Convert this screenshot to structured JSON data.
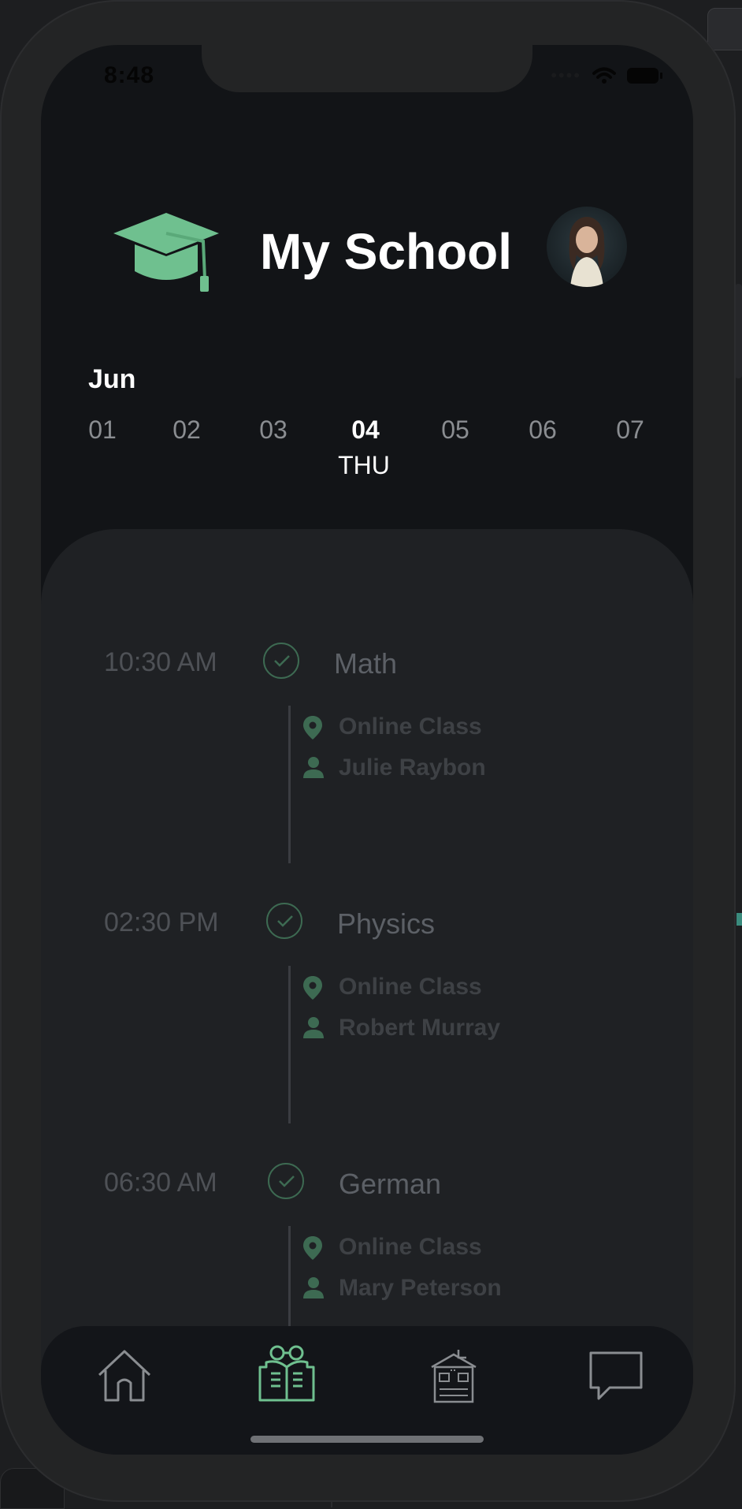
{
  "status": {
    "time": "8:48"
  },
  "header": {
    "title": "My School"
  },
  "calendar": {
    "month": "Jun",
    "days": [
      "01",
      "02",
      "03",
      "04",
      "05",
      "06",
      "07"
    ],
    "selected_weekday": "THU"
  },
  "schedule": [
    {
      "time": "10:30 AM",
      "subject": "Math",
      "location": "Online Class",
      "teacher": "Julie Raybon"
    },
    {
      "time": "02:30 PM",
      "subject": "Physics",
      "location": "Online Class",
      "teacher": "Robert Murray"
    },
    {
      "time": "06:30 AM",
      "subject": "German",
      "location": "Online Class",
      "teacher": "Mary Peterson"
    }
  ],
  "tabs": [
    "home-icon",
    "study-book-icon",
    "school-building-icon",
    "chat-icon"
  ],
  "colors": {
    "accent": "#6fc08f",
    "screen_bg": "#121417",
    "panel_bg": "#1f2124",
    "check_border": "#3d6a52"
  }
}
